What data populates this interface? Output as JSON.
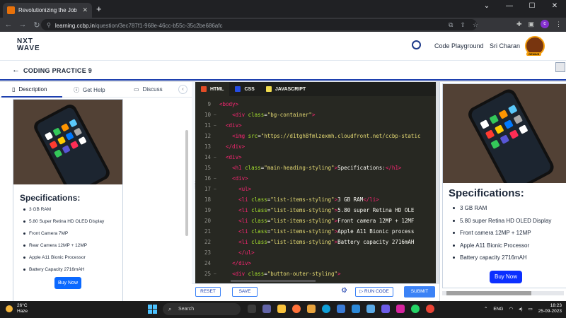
{
  "browser": {
    "tab_title": "Revolutionizing the Job Market",
    "new_tab": "+",
    "url_host": "learning.ccbp.in",
    "url_path": "/question/3ec787f1-968e-46cc-b55c-35c2be686afc",
    "profile_initial": "c",
    "window_controls": [
      "⌄",
      "—",
      "☐",
      "✕"
    ]
  },
  "site": {
    "logo_line1": "NXT",
    "logo_line2": "WAVE",
    "code_playground": "Code Playground",
    "username": "Sri Charan",
    "badge": "GENIUS"
  },
  "practice": {
    "title": "CODING PRACTICE 9"
  },
  "left_tabs": {
    "description": "Description",
    "get_help": "Get Help",
    "discuss": "Discuss"
  },
  "preview": {
    "heading": "Specifications:",
    "items": [
      "3 GB RAM",
      "5.80 Super Retina HD OLED Display",
      "Front Camera 7MP",
      "Rear Camera 12MP + 12MP",
      "Apple A11 Bionic Processor",
      "Battery Capacity 2716mAH"
    ],
    "buy_button": "Buy Now"
  },
  "editor": {
    "tabs": [
      {
        "label": "HTML",
        "color": "#e34c26"
      },
      {
        "label": "CSS",
        "color": "#264de4"
      },
      {
        "label": "JAVASCRIPT",
        "color": "#f0db4f"
      }
    ],
    "lines": [
      {
        "num": "9",
        "fold": "",
        "indent": "",
        "tokens": [
          [
            "t",
            "<body>"
          ]
        ]
      },
      {
        "num": "10",
        "fold": "–",
        "indent": "    ",
        "tokens": [
          [
            "t",
            "<div "
          ],
          [
            "a",
            "class"
          ],
          [
            "p",
            "="
          ],
          [
            "s",
            "\"bg-container\""
          ],
          [
            "t",
            ">"
          ]
        ]
      },
      {
        "num": "11",
        "fold": "–",
        "indent": "  ",
        "tokens": [
          [
            "t",
            "<div>"
          ]
        ]
      },
      {
        "num": "12",
        "fold": "",
        "indent": "    ",
        "tokens": [
          [
            "t",
            "<img "
          ],
          [
            "a",
            "src"
          ],
          [
            "p",
            "="
          ],
          [
            "s",
            "\"https://d1tgh8fmlzexmh.cloudfront.net/ccbp-static"
          ]
        ]
      },
      {
        "num": "13",
        "fold": "",
        "indent": "  ",
        "tokens": [
          [
            "t",
            "</div>"
          ]
        ]
      },
      {
        "num": "14",
        "fold": "–",
        "indent": "  ",
        "tokens": [
          [
            "t",
            "<div>"
          ]
        ]
      },
      {
        "num": "15",
        "fold": "",
        "indent": "    ",
        "tokens": [
          [
            "t",
            "<h1 "
          ],
          [
            "a",
            "class"
          ],
          [
            "p",
            "="
          ],
          [
            "s",
            "\"main-heading-styling\""
          ],
          [
            "t",
            ">"
          ],
          [
            "p",
            "Specifications:"
          ],
          [
            "t",
            "</h1>"
          ]
        ]
      },
      {
        "num": "16",
        "fold": "–",
        "indent": "    ",
        "tokens": [
          [
            "t",
            "<div>"
          ]
        ]
      },
      {
        "num": "17",
        "fold": "–",
        "indent": "      ",
        "tokens": [
          [
            "t",
            "<ul>"
          ]
        ]
      },
      {
        "num": "18",
        "fold": "",
        "indent": "      ",
        "tokens": [
          [
            "t",
            "<li "
          ],
          [
            "a",
            "class"
          ],
          [
            "p",
            "="
          ],
          [
            "s",
            "\"list-items-styling\""
          ],
          [
            "t",
            ">"
          ],
          [
            "p",
            "3 GB RAM"
          ],
          [
            "t",
            "</li>"
          ]
        ]
      },
      {
        "num": "19",
        "fold": "",
        "indent": "      ",
        "tokens": [
          [
            "t",
            "<li "
          ],
          [
            "a",
            "class"
          ],
          [
            "p",
            "="
          ],
          [
            "s",
            "\"list-items-styling\""
          ],
          [
            "t",
            ">"
          ],
          [
            "p",
            "5.80 super Retina HD OLE"
          ]
        ]
      },
      {
        "num": "20",
        "fold": "",
        "indent": "      ",
        "tokens": [
          [
            "t",
            "<li "
          ],
          [
            "a",
            "class"
          ],
          [
            "p",
            "="
          ],
          [
            "s",
            "\"list-items-styling\""
          ],
          [
            "t",
            ">"
          ],
          [
            "p",
            "Front camera 12MP + 12MF"
          ]
        ]
      },
      {
        "num": "21",
        "fold": "",
        "indent": "      ",
        "tokens": [
          [
            "t",
            "<li "
          ],
          [
            "a",
            "class"
          ],
          [
            "p",
            "="
          ],
          [
            "s",
            "\"list-items-styling\""
          ],
          [
            "t",
            ">"
          ],
          [
            "p",
            "Apple A11 Bionic process"
          ]
        ]
      },
      {
        "num": "22",
        "fold": "",
        "indent": "      ",
        "tokens": [
          [
            "t",
            "<li "
          ],
          [
            "a",
            "class"
          ],
          [
            "p",
            "="
          ],
          [
            "s",
            "\"list-items-styling\""
          ],
          [
            "t",
            ">"
          ],
          [
            "p",
            "Battery capacity 2716mAH"
          ]
        ]
      },
      {
        "num": "23",
        "fold": "",
        "indent": "      ",
        "tokens": [
          [
            "t",
            "</ul>"
          ]
        ]
      },
      {
        "num": "24",
        "fold": "",
        "indent": "    ",
        "tokens": [
          [
            "t",
            "</div>"
          ]
        ]
      },
      {
        "num": "25",
        "fold": "–",
        "indent": "    ",
        "tokens": [
          [
            "t",
            "<div "
          ],
          [
            "a",
            "class"
          ],
          [
            "p",
            "="
          ],
          [
            "s",
            "\"button-outer-styling\""
          ],
          [
            "t",
            ">"
          ]
        ]
      }
    ]
  },
  "footer": {
    "reset": "RESET",
    "save": "SAVE",
    "run_code": "▷ RUN CODE",
    "submit": "SUBMIT"
  },
  "output": {
    "heading": "Specifications:",
    "items": [
      "3 GB RAM",
      "5.80 super Retina HD OLED Display",
      "Front camera 12MP + 12MP",
      "Apple A11 Bionic Processor",
      "Battery capacity 2716mAH"
    ],
    "buy_button": "Buy Now"
  },
  "taskbar": {
    "temp": "26°C",
    "condition": "Haze",
    "search": "Search",
    "lang": "ENG",
    "time": "18:23",
    "date": "25-09-2023"
  }
}
